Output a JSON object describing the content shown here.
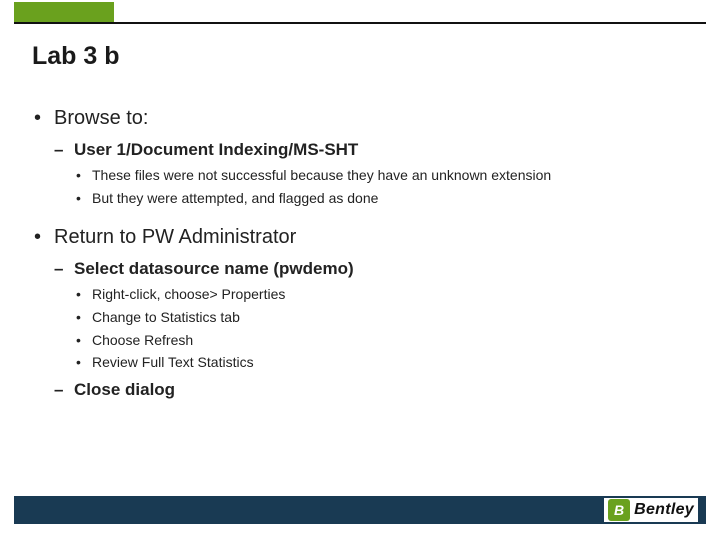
{
  "title": "Lab 3 b",
  "bullets": [
    {
      "text": "Browse to:",
      "children": [
        {
          "text": "User 1/Document Indexing/MS-SHT",
          "children": [
            {
              "text": "These files were not successful because they have an unknown extension"
            },
            {
              "text": "But they were attempted, and flagged as done"
            }
          ]
        }
      ]
    },
    {
      "text": "Return to PW Administrator",
      "children": [
        {
          "text": "Select datasource name (pwdemo)",
          "children": [
            {
              "text": "Right-click, choose> Properties"
            },
            {
              "text": "Change to Statistics tab"
            },
            {
              "text": "Choose Refresh"
            },
            {
              "text": "Review Full Text Statistics"
            }
          ]
        },
        {
          "text": "Close dialog"
        }
      ]
    }
  ],
  "logo": {
    "mark": "B",
    "text": "Bentley"
  }
}
